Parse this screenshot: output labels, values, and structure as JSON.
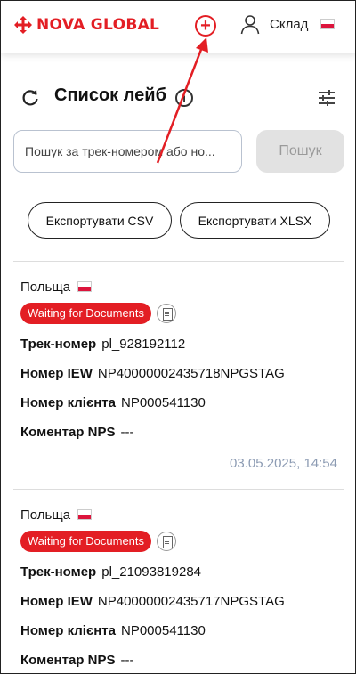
{
  "header": {
    "brand": "NOVA GLOBAL",
    "user_label": "Склад",
    "brand_color": "#e31e24"
  },
  "page": {
    "title": "Список лейб",
    "info_glyph": "i"
  },
  "search": {
    "placeholder": "Пошук за трек-номером або но...",
    "button_label": "Пошук"
  },
  "export": {
    "csv_label": "Експортувати CSV",
    "xlsx_label": "Експортувати XLSX"
  },
  "labels": {
    "track": "Трек-номер",
    "iew": "Номер IEW",
    "client": "Номер клієнта",
    "comment": "Коментар NPS"
  },
  "cards": [
    {
      "country": "Польща",
      "status": "Waiting for Documents",
      "track": "pl_928192112",
      "iew": "NP40000002435718NPGSTAG",
      "client": "NP000541130",
      "comment": "---",
      "timestamp": "03.05.2025, 14:54"
    },
    {
      "country": "Польща",
      "status": "Waiting for Documents",
      "track": "pl_21093819284",
      "iew": "NP40000002435717NPGSTAG",
      "client": "NP000541130",
      "comment": "---"
    }
  ]
}
